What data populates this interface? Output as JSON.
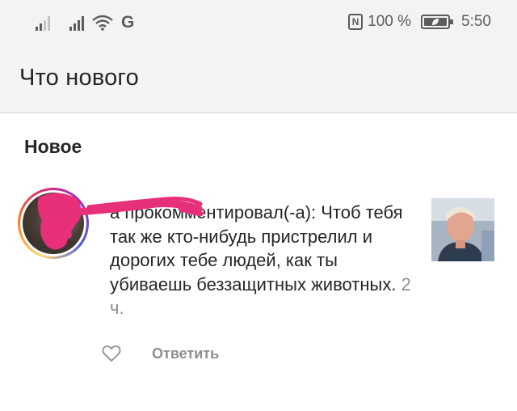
{
  "status_bar": {
    "signal_1_icon": "cellular-signal-icon",
    "signal_2_icon": "cellular-signal-icon",
    "wifi_icon": "wifi-icon",
    "network_type": "G",
    "nfc_icon": "nfc-icon",
    "nfc_label": "N",
    "battery_percent": "100 %",
    "battery_icon": "battery-saver-icon",
    "time": "5:50"
  },
  "app_bar": {
    "title": "Что нового"
  },
  "section": {
    "title": "Новое"
  },
  "notification": {
    "username_redacted": true,
    "text": "а прокомментировал(-а): Чтоб тебя так же кто-нибудь пристрелил и дорогих тебе людей, как ты убиваешь беззащитных животных.",
    "time": "2 ч.",
    "like_icon": "heart-outline-icon",
    "reply_label": "Ответить"
  },
  "colors": {
    "redaction": "#e8307a",
    "ring": [
      "#feda75",
      "#fa7e1e",
      "#d62976",
      "#962fbf",
      "#4f5bd5"
    ],
    "secondary_text": "#8e8e8e"
  }
}
